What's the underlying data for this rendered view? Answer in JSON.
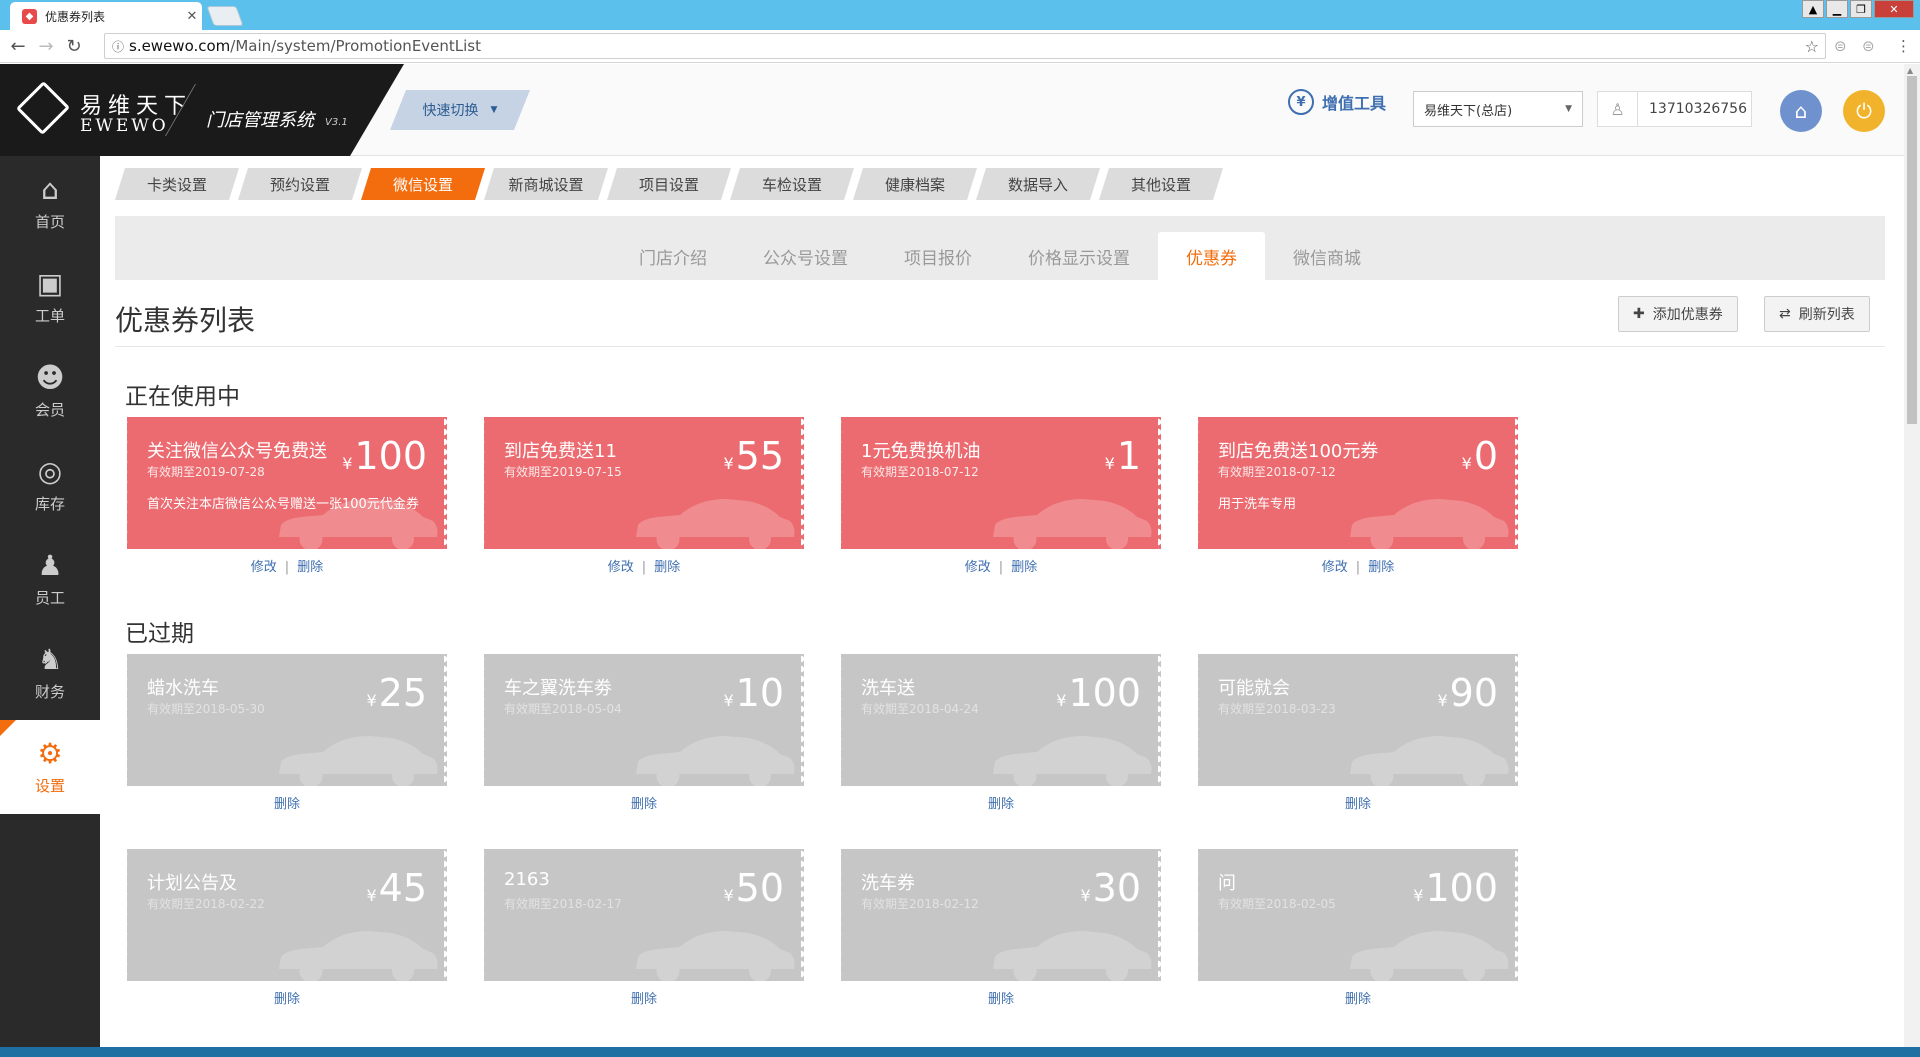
{
  "browser": {
    "tab_title": "优惠券列表",
    "url_domain": "s.ewewo.com",
    "url_path": "/Main/system/PromotionEventList"
  },
  "header": {
    "logo_cn": "易维天下",
    "logo_en": "EWEWO",
    "system_name": "门店管理系统",
    "version": "V3.1",
    "quick_switch": "快速切换",
    "value_tools": "增值工具",
    "store": "易维天下(总店)",
    "user_phone": "13710326756"
  },
  "sidebar": {
    "items": [
      {
        "label": "首页",
        "icon": "home-icon"
      },
      {
        "label": "工单",
        "icon": "work-order-icon"
      },
      {
        "label": "会员",
        "icon": "member-icon"
      },
      {
        "label": "库存",
        "icon": "inventory-icon"
      },
      {
        "label": "员工",
        "icon": "staff-icon"
      },
      {
        "label": "财务",
        "icon": "finance-icon"
      },
      {
        "label": "设置",
        "icon": "gear-icon"
      }
    ]
  },
  "main_tabs": [
    "卡类设置",
    "预约设置",
    "微信设置",
    "新商城设置",
    "项目设置",
    "车检设置",
    "健康档案",
    "数据导入",
    "其他设置"
  ],
  "sub_tabs": [
    "门店介绍",
    "公众号设置",
    "项目报价",
    "价格显示设置",
    "优惠券",
    "微信商城"
  ],
  "page": {
    "title": "优惠券列表",
    "add_button": "添加优惠券",
    "refresh_button": "刷新列表"
  },
  "sections": {
    "active_title": "正在使用中",
    "expired_title": "已过期"
  },
  "actions": {
    "edit": "修改",
    "delete": "删除",
    "separator": "|"
  },
  "currency": "¥",
  "active_coupons": [
    {
      "name": "关注微信公众号免费送",
      "valid": "有效期至2019-07-28",
      "price": "100",
      "desc": "首次关注本店微信公众号赠送一张100元代金券"
    },
    {
      "name": "到店免费送11",
      "valid": "有效期至2019-07-15",
      "price": "55",
      "desc": ""
    },
    {
      "name": "1元免费换机油",
      "valid": "有效期至2018-07-12",
      "price": "1",
      "desc": ""
    },
    {
      "name": "到店免费送100元券",
      "valid": "有效期至2018-07-12",
      "price": "0",
      "desc": "用于洗车专用"
    }
  ],
  "expired_coupons": [
    {
      "name": "蜡水洗车",
      "valid": "有效期至2018-05-30",
      "price": "25"
    },
    {
      "name": "车之翼洗车劵",
      "valid": "有效期至2018-05-04",
      "price": "10"
    },
    {
      "name": "洗车送",
      "valid": "有效期至2018-04-24",
      "price": "100"
    },
    {
      "name": "可能就会",
      "valid": "有效期至2018-03-23",
      "price": "90"
    },
    {
      "name": "计划公告及",
      "valid": "有效期至2018-02-22",
      "price": "45"
    },
    {
      "name": "2163",
      "valid": "有效期至2018-02-17",
      "price": "50"
    },
    {
      "name": "洗车券",
      "valid": "有效期至2018-02-12",
      "price": "30"
    },
    {
      "name": "问",
      "valid": "有效期至2018-02-05",
      "price": "100"
    }
  ]
}
